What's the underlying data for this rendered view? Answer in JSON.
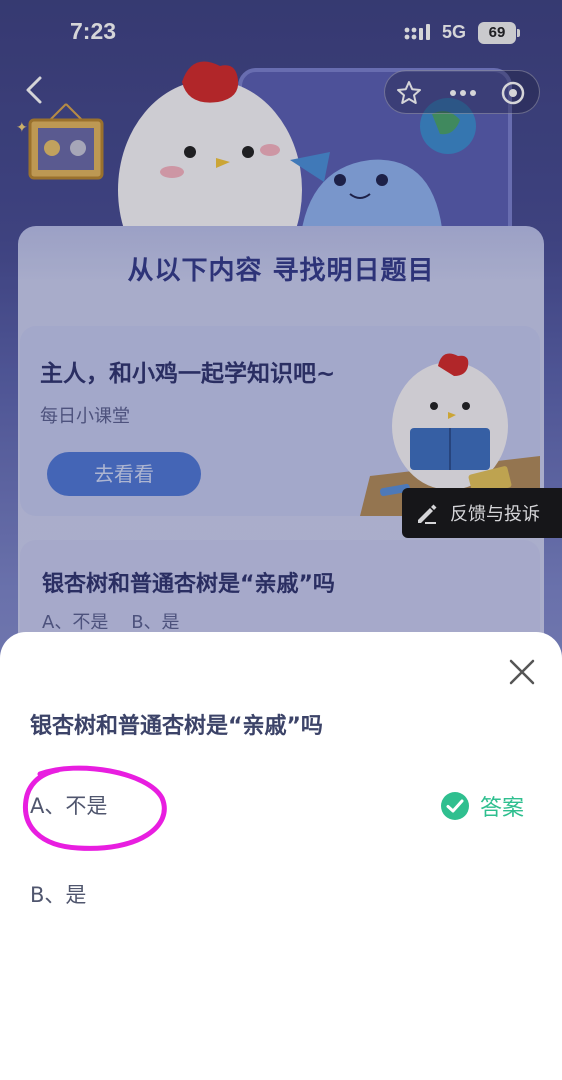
{
  "status_bar": {
    "time": "7:23",
    "network": "5G",
    "battery": "69"
  },
  "nav": {
    "back_icon": "chevron-left-icon",
    "capsule_icons": [
      "star-icon",
      "more-dots-icon",
      "record-icon"
    ]
  },
  "section_title": "从以下内容 寻找明日题目",
  "lesson_card": {
    "title": "主人，和小鸡一起学知识吧~",
    "subtitle": "每日小课堂",
    "button_label": "去看看"
  },
  "feedback": {
    "label": "反馈与投诉",
    "icon": "pen-icon"
  },
  "background_question": {
    "title": "银杏树和普通杏树是“亲戚”吗",
    "options_line": "A、不是    B、是"
  },
  "sheet": {
    "question": "银杏树和普通杏树是“亲戚”吗",
    "option_a": "A、不是",
    "option_b": "B、是",
    "answer_label": "答案",
    "close_icon": "close-icon"
  },
  "colors": {
    "accent_green": "#2fbf8f",
    "annotation_magenta": "#e81ee0",
    "title_blue": "#333a8a",
    "button_blue": "#4f77d6"
  }
}
